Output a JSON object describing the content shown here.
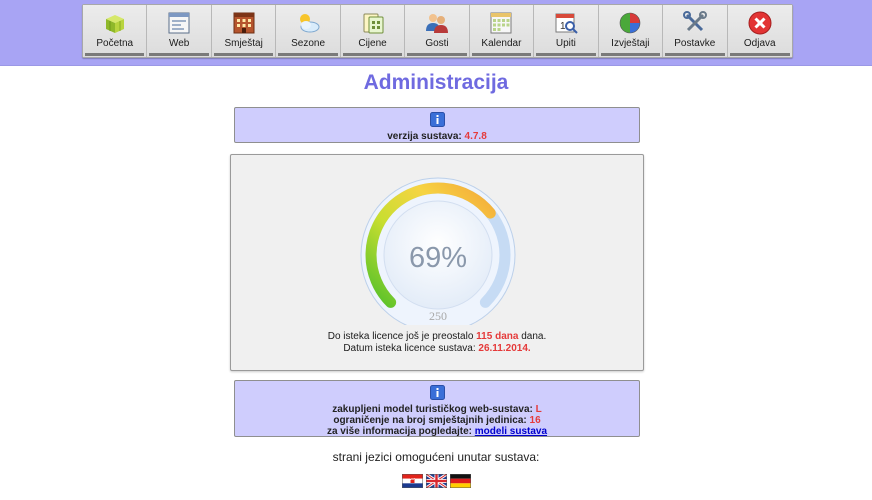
{
  "toolbar": {
    "items": [
      {
        "label": "Početna",
        "icon": "home-blocks-icon"
      },
      {
        "label": "Web",
        "icon": "web-page-icon"
      },
      {
        "label": "Smještaj",
        "icon": "building-icon"
      },
      {
        "label": "Sezone",
        "icon": "weather-icon"
      },
      {
        "label": "Cijene",
        "icon": "price-tags-icon"
      },
      {
        "label": "Gosti",
        "icon": "guests-icon"
      },
      {
        "label": "Kalendar",
        "icon": "calendar-icon"
      },
      {
        "label": "Upiti",
        "icon": "inquiry-calendar-icon"
      },
      {
        "label": "Izvještaji",
        "icon": "pie-chart-icon"
      },
      {
        "label": "Postavke",
        "icon": "tools-icon"
      },
      {
        "label": "Odjava",
        "icon": "logout-icon"
      }
    ]
  },
  "page": {
    "title": "Administracija"
  },
  "version": {
    "label": "verzija sustava:",
    "value": "4.7.8"
  },
  "gauge": {
    "percent_text": "69%",
    "percent": 69,
    "scale_max": "250"
  },
  "license": {
    "line1_prefix": "Do isteka licence još je preostalo",
    "days": "115 dana",
    "line1_suffix": "dana.",
    "line2_prefix": "Datum isteka licence sustava:",
    "date": "26.11.2014."
  },
  "plan": {
    "model_label": "zakupljeni model turističkog web-sustava:",
    "model_value": "L",
    "limit_label": "ograničenje na broj smještajnih jedinica:",
    "limit_value": "16",
    "more_label": "za više informacija pogledajte:",
    "more_link": "modeli sustava"
  },
  "languages": {
    "label": "strani jezici omogućeni unutar sustava:",
    "flags": [
      "croatia-flag-icon",
      "uk-flag-icon",
      "germany-flag-icon"
    ]
  },
  "colors": {
    "accent": "#6f6ae0",
    "header_bg": "#a8a4f4",
    "info_bg": "#cfcdfd",
    "highlight": "#e53a3a"
  }
}
